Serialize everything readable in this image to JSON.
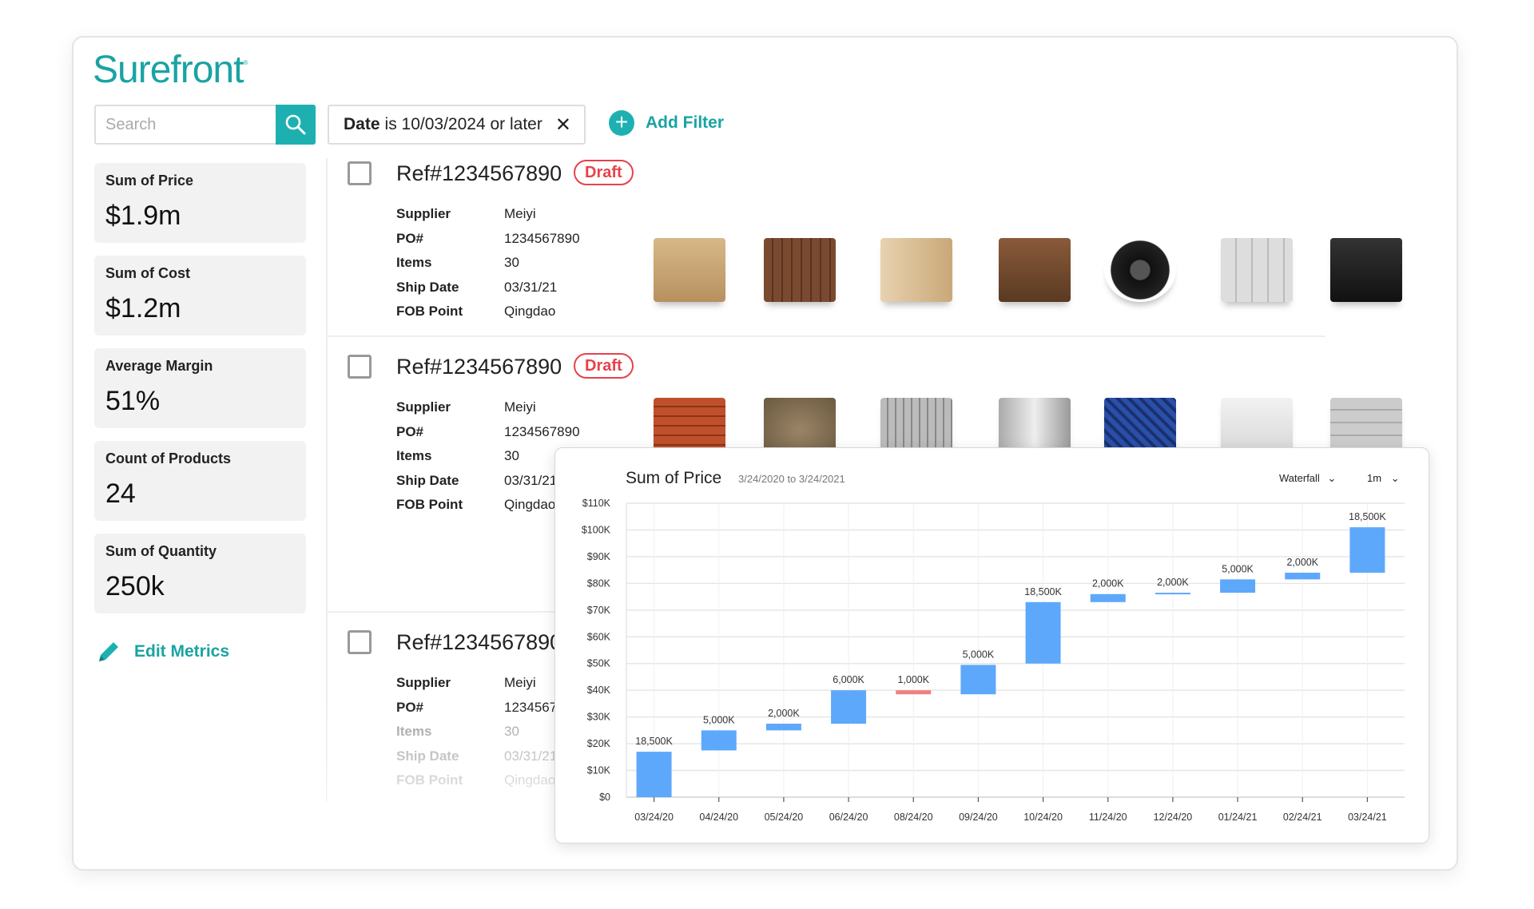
{
  "brand": {
    "logo": "Surefront",
    "accent": "#1eb0b0"
  },
  "search": {
    "placeholder": "Search",
    "icon": "search-icon"
  },
  "filter": {
    "field": "Date",
    "text": "is 10/03/2024 or later",
    "remove_icon": "close-icon"
  },
  "add_filter": {
    "label": "Add Filter",
    "icon": "plus-circle-icon"
  },
  "metrics": [
    {
      "label": "Sum of Price",
      "value": "$1.9m"
    },
    {
      "label": "Sum of Cost",
      "value": "$1.2m"
    },
    {
      "label": "Average Margin",
      "value": "51%"
    },
    {
      "label": "Count of Products",
      "value": "24"
    },
    {
      "label": "Sum of Quantity",
      "value": "250k"
    }
  ],
  "edit_metrics": {
    "label": "Edit Metrics",
    "icon": "pencil-icon"
  },
  "field_labels": [
    "Supplier",
    "PO#",
    "Items",
    "Ship Date",
    "FOB Point"
  ],
  "orders": [
    {
      "ref": "Ref#1234567890",
      "status": "Draft",
      "values": [
        "Meiyi",
        "1234567890",
        "30",
        "03/31/21",
        "Qingdao"
      ],
      "products": [
        "pallet-boxes",
        "wood-pallet",
        "paper-rolls",
        "logs",
        "tires",
        "paint-cans",
        "tiles"
      ]
    },
    {
      "ref": "Ref#1234567890",
      "status": "Draft",
      "values": [
        "Meiyi",
        "1234567890",
        "30",
        "03/31/21",
        "Qingdao"
      ],
      "products": [
        "bricks",
        "sacks",
        "pallet-goods",
        "bucket",
        "crate",
        "boards",
        "blocks"
      ]
    },
    {
      "ref": "Ref#1234567890",
      "status": "",
      "values": [
        "Meiyi",
        "1234567890",
        "30",
        "03/31/21",
        "Qingdao"
      ],
      "products": []
    }
  ],
  "chart_data": {
    "type": "waterfall",
    "title": "Sum of Price",
    "subtitle": "3/24/2020 to 3/24/2021",
    "chart_type_select": "Waterfall",
    "interval_select": "1m",
    "categories": [
      "03/24/20",
      "04/24/20",
      "05/24/20",
      "06/24/20",
      "08/24/20",
      "09/24/20",
      "10/24/20",
      "11/24/20",
      "12/24/20",
      "01/24/21",
      "02/24/21",
      "03/24/21"
    ],
    "bars": [
      {
        "start": 0,
        "end": 17000,
        "label": "18,500K",
        "direction": "up"
      },
      {
        "start": 17500,
        "end": 25000,
        "label": "5,000K",
        "direction": "up"
      },
      {
        "start": 25000,
        "end": 27500,
        "label": "2,000K",
        "direction": "up"
      },
      {
        "start": 27500,
        "end": 40000,
        "label": "6,000K",
        "direction": "up"
      },
      {
        "start": 40000,
        "end": 38500,
        "label": "1,000K",
        "direction": "down"
      },
      {
        "start": 38500,
        "end": 49500,
        "label": "5,000K",
        "direction": "up"
      },
      {
        "start": 50000,
        "end": 73000,
        "label": "18,500K",
        "direction": "up"
      },
      {
        "start": 73000,
        "end": 76000,
        "label": "2,000K",
        "direction": "up"
      },
      {
        "start": 76000,
        "end": 76500,
        "label": "2,000K",
        "direction": "up"
      },
      {
        "start": 76500,
        "end": 81500,
        "label": "5,000K",
        "direction": "up"
      },
      {
        "start": 81500,
        "end": 84000,
        "label": "2,000K",
        "direction": "up"
      },
      {
        "start": 84000,
        "end": 101000,
        "label": "18,500K",
        "direction": "up"
      }
    ],
    "y_ticks": [
      "$0",
      "$10K",
      "$20K",
      "$30K",
      "$40K",
      "$50K",
      "$60K",
      "$70K",
      "$80K",
      "$90K",
      "$100K",
      "$110K"
    ],
    "ylim": [
      0,
      110000
    ],
    "grid": true,
    "colors": {
      "up": "#5ea8fb",
      "down": "#f08080"
    }
  }
}
